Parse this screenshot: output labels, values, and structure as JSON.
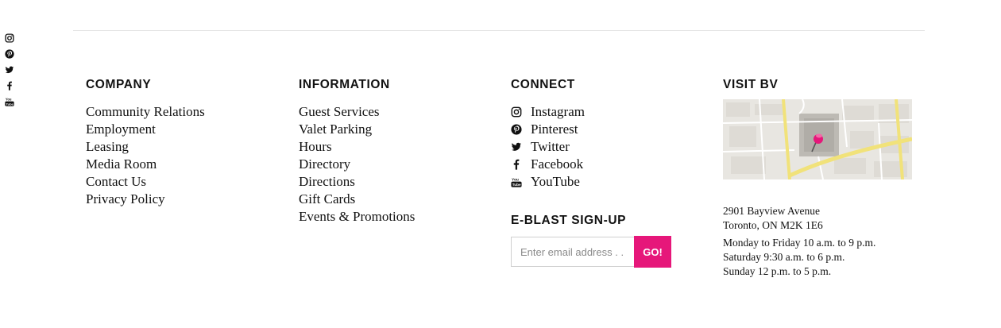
{
  "social_rail": {
    "icons": [
      "instagram-icon",
      "pinterest-icon",
      "twitter-icon",
      "facebook-icon",
      "youtube-icon"
    ]
  },
  "company": {
    "title": "COMPANY",
    "links": [
      "Community Relations",
      "Employment",
      "Leasing",
      "Media Room",
      "Contact Us",
      "Privacy Policy"
    ]
  },
  "information": {
    "title": "INFORMATION",
    "links": [
      "Guest Services",
      "Valet Parking",
      "Hours",
      "Directory",
      "Directions",
      "Gift Cards",
      "Events & Promotions"
    ]
  },
  "connect": {
    "title": "CONNECT",
    "items": [
      {
        "label": "Instagram",
        "icon": "instagram-icon"
      },
      {
        "label": "Pinterest",
        "icon": "pinterest-icon"
      },
      {
        "label": "Twitter",
        "icon": "twitter-icon"
      },
      {
        "label": "Facebook",
        "icon": "facebook-icon"
      },
      {
        "label": "YouTube",
        "icon": "youtube-icon"
      }
    ]
  },
  "eblast": {
    "title": "E-BLAST SIGN-UP",
    "placeholder": "Enter email address . . .",
    "button_label": "GO!",
    "button_color": "#e6177a"
  },
  "visit": {
    "title": "VISIT BV",
    "address_line1": "2901 Bayview Avenue",
    "address_line2": "Toronto, ON M2K 1E6",
    "hours_weekday": "Monday to Friday 10 a.m. to 9 p.m.",
    "hours_saturday": "Saturday 9:30 a.m. to 6 p.m.",
    "hours_sunday": "Sunday 12 p.m. to 5 p.m.",
    "pin_color": "#e6177a"
  }
}
